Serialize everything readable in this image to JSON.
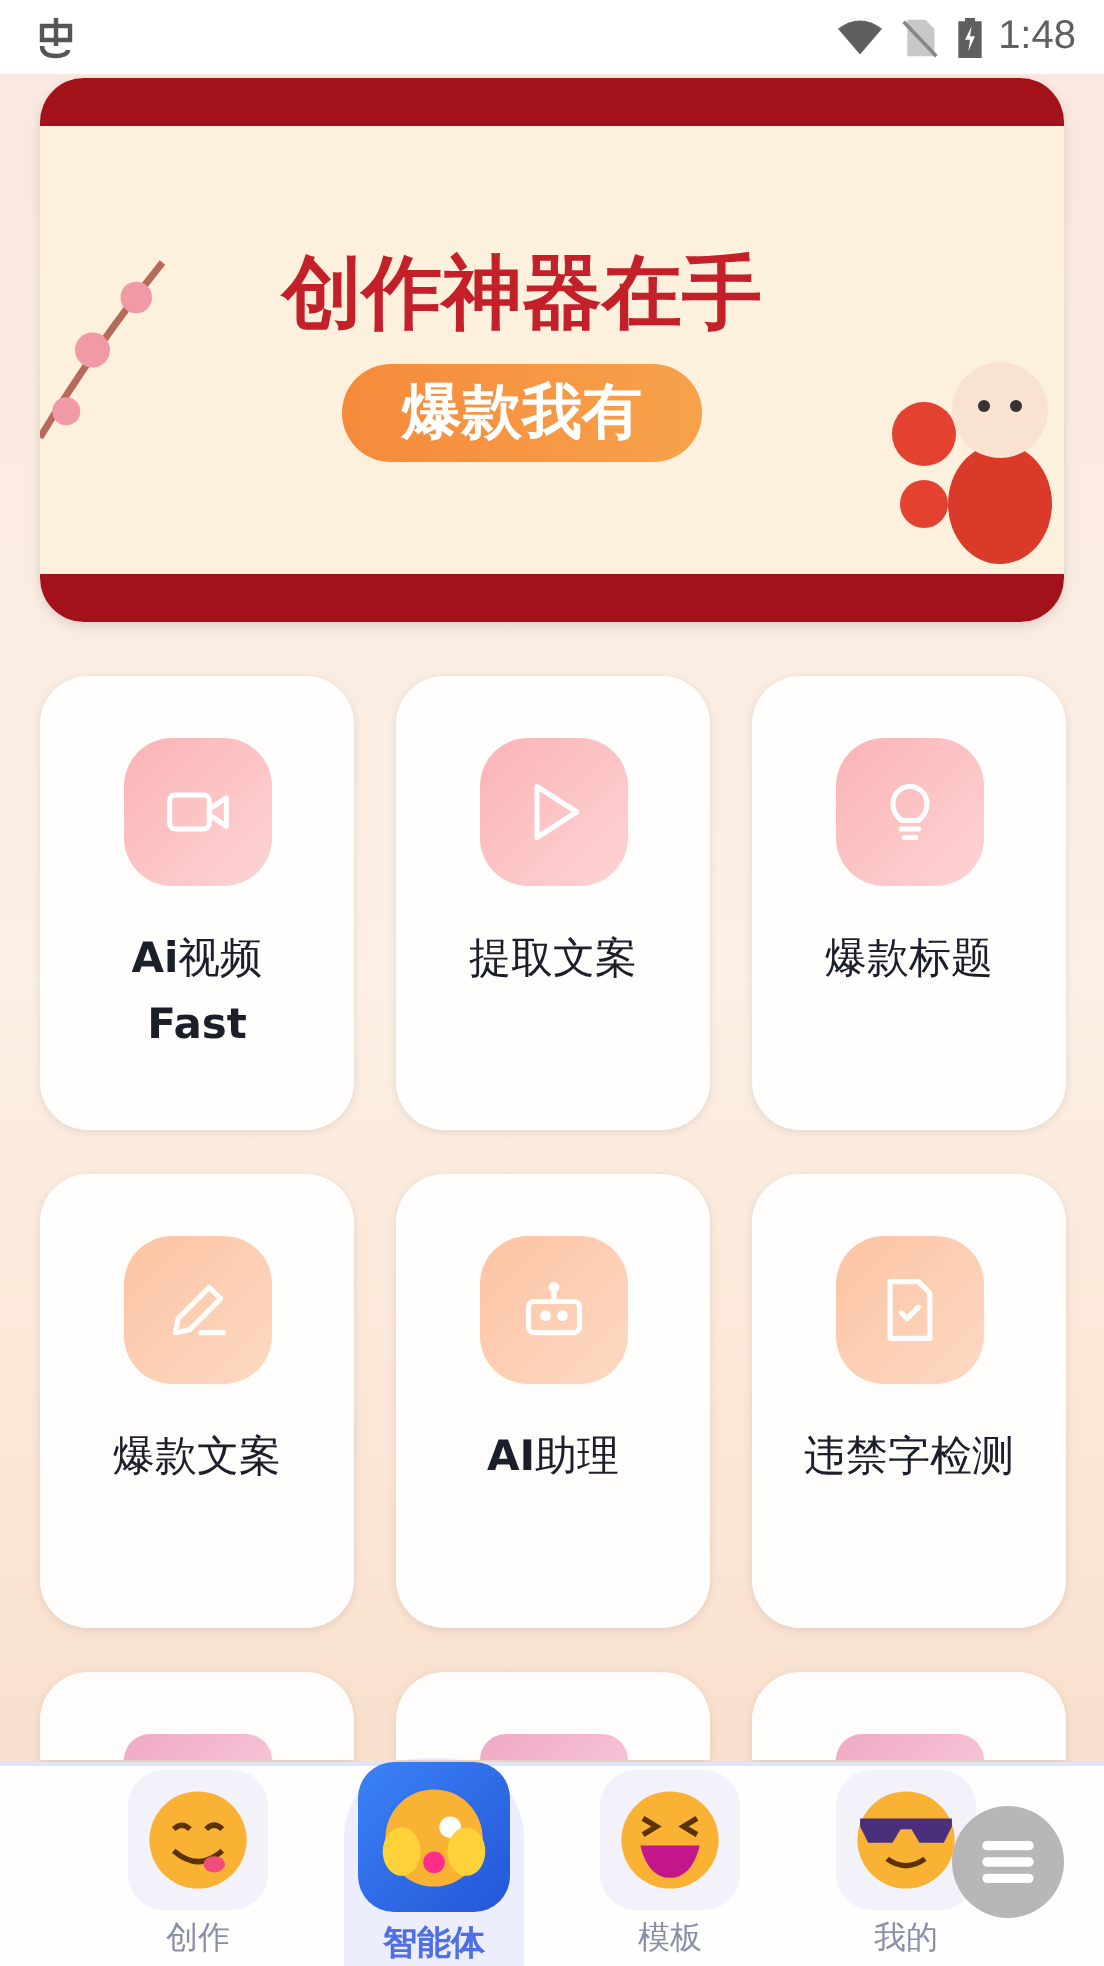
{
  "status_bar": {
    "time": "1:48"
  },
  "banner": {
    "headline": "创作神器在手",
    "tagline": "爆款我有"
  },
  "tools": [
    {
      "label": "**Ai**视频 **Fast**",
      "kind": "video"
    },
    {
      "label": "提取文案",
      "kind": "play"
    },
    {
      "label": "爆款标题",
      "kind": "bulb"
    },
    {
      "label": "爆款文案",
      "kind": "pen"
    },
    {
      "label": "**AI**助理",
      "kind": "robot"
    },
    {
      "label": "违禁字检测",
      "kind": "doc"
    },
    {
      "kind": "partial"
    },
    {
      "kind": "partial"
    },
    {
      "kind": "partial"
    }
  ],
  "bottom_nav": [
    {
      "label": "创作",
      "kind": "tongue",
      "selected": false
    },
    {
      "label": "智能体",
      "kind": "peek",
      "selected": true
    },
    {
      "label": "模板",
      "kind": "laugh",
      "selected": false
    },
    {
      "label": "我的",
      "kind": "cool",
      "selected": false
    }
  ]
}
